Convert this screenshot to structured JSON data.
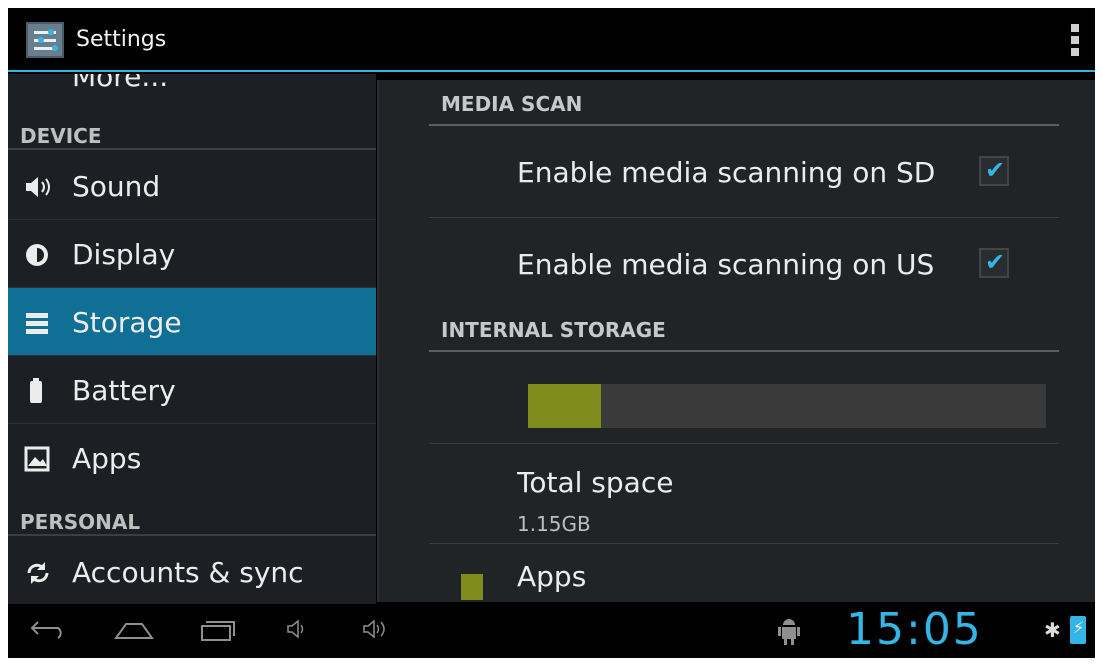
{
  "actionbar": {
    "title": "Settings",
    "app_icon": "settings-sliders-icon",
    "overflow_icon": "overflow-menu-icon"
  },
  "sidebar": {
    "partial_item_label": "More...",
    "device_header": "DEVICE",
    "personal_header": "PERSONAL",
    "items": [
      {
        "label": "Sound",
        "icon": "speaker-icon"
      },
      {
        "label": "Display",
        "icon": "brightness-icon"
      },
      {
        "label": "Storage",
        "icon": "storage-icon"
      },
      {
        "label": "Battery",
        "icon": "battery-icon"
      },
      {
        "label": "Apps",
        "icon": "apps-icon"
      },
      {
        "label": "Accounts & sync",
        "icon": "sync-icon"
      }
    ],
    "selected_index": 2
  },
  "content": {
    "media_scan_header": "MEDIA SCAN",
    "scan_sd_label": "Enable media scanning on SD",
    "scan_sd_checked": true,
    "scan_usb_label": "Enable media scanning on USB",
    "scan_usb_checked": true,
    "internal_storage_header": "INTERNAL STORAGE",
    "storage_used_fraction": 0.14,
    "total_space_label": "Total space",
    "total_space_value": "1.15GB",
    "apps_label": "Apps"
  },
  "systembar": {
    "back_icon": "back-icon",
    "home_icon": "home-icon",
    "recents_icon": "recent-apps-icon",
    "volume_down_icon": "volume-down-icon",
    "volume_up_icon": "volume-up-icon",
    "debug_icon": "usb-debugging-icon",
    "clock": "15:05",
    "bluetooth_icon": "bluetooth-icon",
    "battery_icon": "battery-charging-icon"
  },
  "colors": {
    "accent": "#33b5e5",
    "selected_bg": "#0f6f95",
    "storage_fill": "#808b1e"
  }
}
